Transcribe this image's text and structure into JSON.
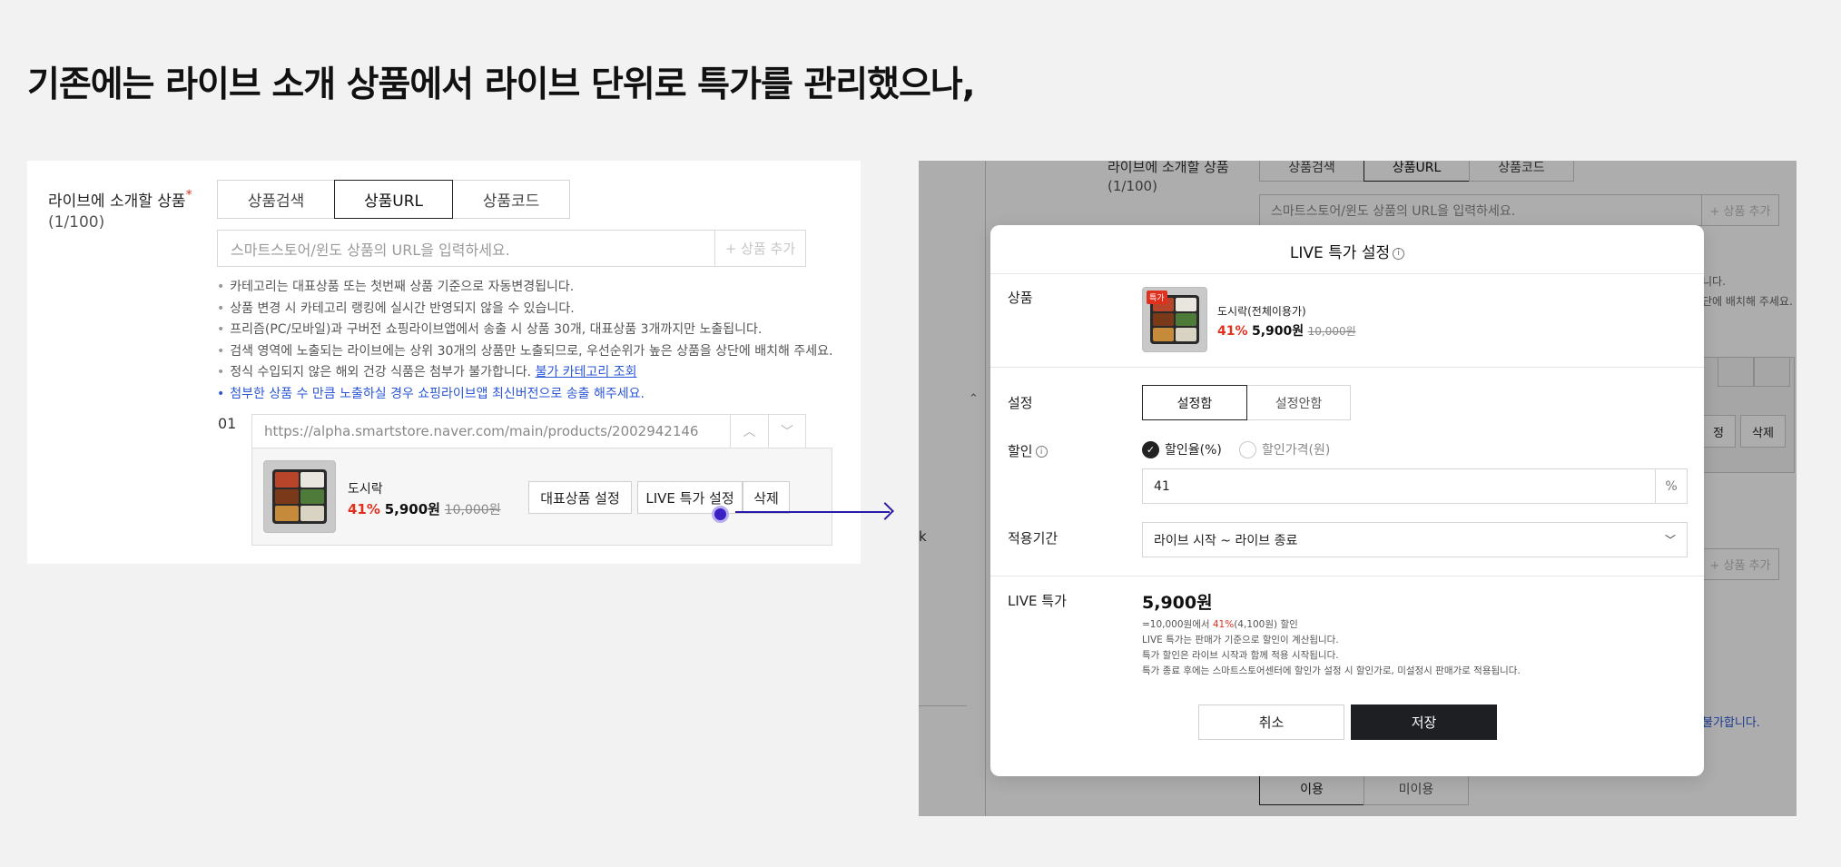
{
  "heading": "기존에는 라이브 소개 상품에서 라이브 단위로 특가를 관리했으나,",
  "left_panel": {
    "label": "라이브에 소개할 상품",
    "required_mark": "*",
    "count": "(1/100)",
    "tabs": [
      "상품검색",
      "상품URL",
      "상품코드"
    ],
    "active_tab": "상품URL",
    "url_placeholder": "스마트스토어/윈도 상품의 URL을 입력하세요.",
    "add_button": "+ 상품 추가",
    "notes": [
      "카테고리는 대표상품 또는 첫번째 상품 기준으로 자동변경됩니다.",
      "상품 변경 시 카테고리 랭킹에 실시간 반영되지 않을 수 있습니다.",
      "프리즘(PC/모바일)과 구버전 쇼핑라이브앱에서 송출 시 상품 30개, 대표상품 3개까지만 노출됩니다.",
      "검색 영역에 노출되는 라이브에는 상위 30개의 상품만 노출되므로, 우선순위가 높은 상품을 상단에 배치해 주세요.",
      "정식 수입되지 않은 해외 건강 식품은 첨부가 불가합니다."
    ],
    "note_link": "불가 카테고리 조회",
    "note_blue": "첨부한 상품 수 만큼 노출하실 경우 쇼핑라이브앱 최신버전으로 송출 해주세요.",
    "item": {
      "index": "01",
      "url": "https://alpha.smartstore.naver.com/main/products/2002942146",
      "name": "도시락",
      "discount": "41%",
      "sale_price": "5,900원",
      "original_price": "10,000원",
      "buttons": {
        "main_product": "대표상품 설정",
        "live_special": "LIVE 특가 설정",
        "delete": "삭제"
      }
    }
  },
  "background_page": {
    "label": "라이브에 소개할 상품",
    "count": "(1/100)",
    "tabs": [
      "상품검색",
      "상품URL",
      "상품코드"
    ],
    "url_placeholder": "스마트스토어/윈도 상품의 URL을 입력하세요.",
    "add_button": "+ 상품 추가",
    "fragment_1": "니다.",
    "fragment_2": "단에 배치해 주세요.",
    "fragment_3": "정",
    "fragment_4": "삭제",
    "fragment_5": "불가합니다.",
    "bottom_btn_1": "이용",
    "bottom_btn_2": "미이용"
  },
  "modal": {
    "title": "LIVE 특가 설정",
    "product_label": "상품",
    "product": {
      "badge": "특가",
      "name": "도시락(전체이용가)",
      "discount": "41%",
      "sale_price": "5,900원",
      "original_price": "10,000원"
    },
    "setting_label": "설정",
    "setting_options": [
      "설정함",
      "설정안함"
    ],
    "setting_selected": "설정함",
    "discount_label": "할인",
    "discount_options": [
      "할인율(%)",
      "할인가격(원)"
    ],
    "discount_selected": "할인율(%)",
    "discount_value": "41",
    "discount_unit": "%",
    "period_label": "적용기간",
    "period_value": "라이브 시작 ~ 라이브 종료",
    "live_price_label": "LIVE 특가",
    "live_price": "5,900원",
    "calc_prefix": "=10,000원에서 ",
    "calc_rate": "41%",
    "calc_suffix": "(4,100원) 할인",
    "notes": [
      "LIVE 특가는 판매가 기준으로 할인이 계산됩니다.",
      "특가 할인은 라이브 시작과 함께 적용 시작됩니다.",
      "특가 종료 후에는 스마트스토어센터에 할인가 설정 시 할인가로, 미설정시 판매가로 적용됩니다."
    ],
    "cancel": "취소",
    "save": "저장"
  }
}
